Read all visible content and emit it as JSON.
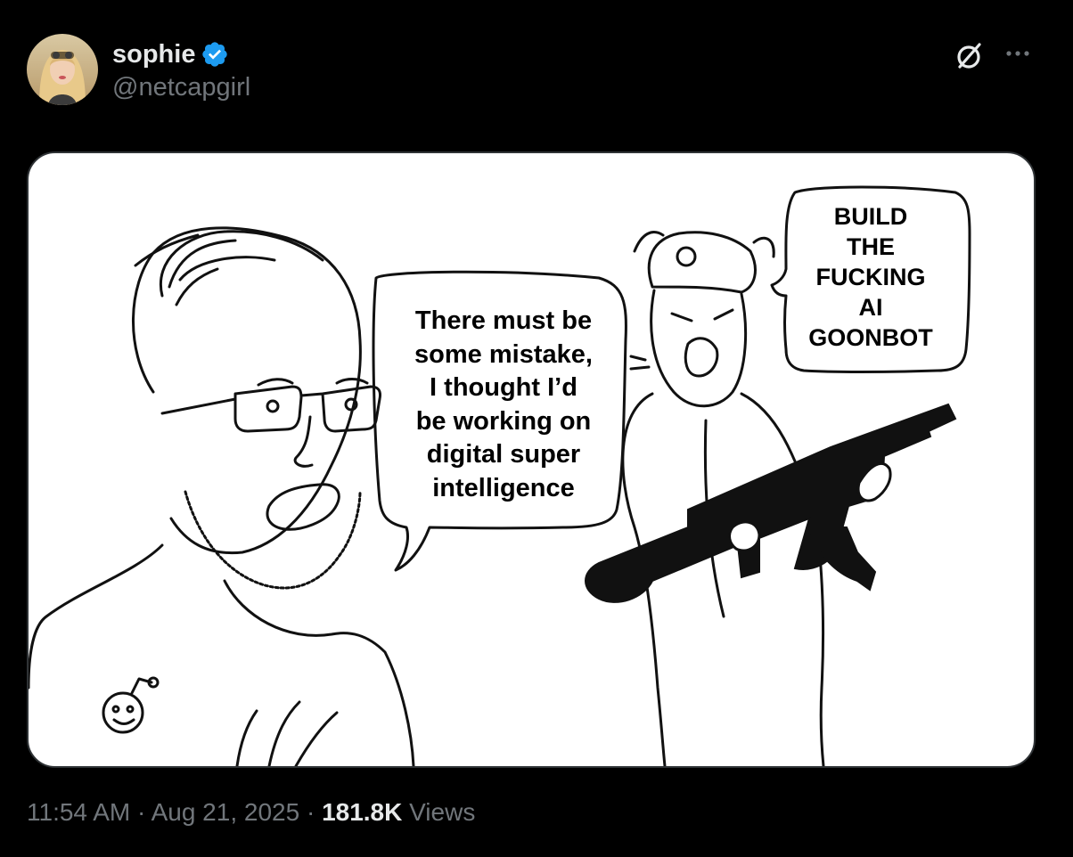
{
  "author": {
    "display_name": "sophie",
    "handle": "@netcapgirl",
    "verified": true
  },
  "icons": {
    "verified": "verified-badge-icon",
    "grok": "grok-icon",
    "more": "more-options-icon"
  },
  "colors": {
    "background": "#000000",
    "primary_text": "#e7e9ea",
    "secondary_text": "#71767b",
    "verified_blue": "#1d9bf0",
    "media_border": "#2f3336"
  },
  "media": {
    "bubble_left": "There must be\nsome mistake,\nI thought I’d\nbe working on\ndigital super\nintelligence",
    "bubble_right": "BUILD\nTHE\nFUCKING\nAI\nGOONBOT"
  },
  "meta": {
    "time": "11:54 AM",
    "separator": " · ",
    "date": "Aug 21, 2025",
    "views_count": "181.8K",
    "views_label": " Views"
  }
}
